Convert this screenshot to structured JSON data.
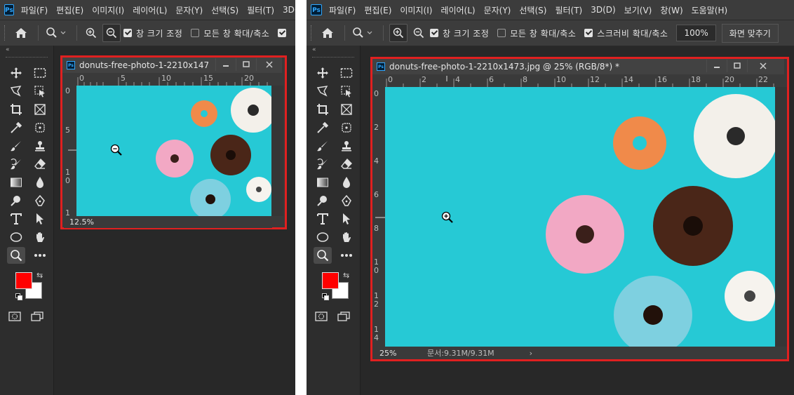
{
  "menu": [
    "파일(F)",
    "편집(E)",
    "이미지(I)",
    "레이어(L)",
    "문자(Y)",
    "선택(S)",
    "필터(T)",
    "3D(D)",
    "보기(V)",
    "창(W)",
    "도움말(H)"
  ],
  "options": {
    "fit_window": "창 크기 조정",
    "zoom_all": "모든 창 확대/축소",
    "scrubby_zoom": "스크러비 확대/축소",
    "percent": "100%",
    "fit_screen": "화면 맞추기"
  },
  "left_panel": {
    "doc_title": "donuts-free-photo-1-2210x147...",
    "zoom": "12.5%",
    "ruler_h": [
      "0",
      "5",
      "10",
      "15",
      "20"
    ],
    "ruler_v": [
      "0",
      "5",
      "10",
      "1"
    ],
    "active_zoom_tool": "zoom-out",
    "cursor": "zoom-out-cursor"
  },
  "right_panel": {
    "doc_title": "donuts-free-photo-1-2210x1473.jpg @ 25% (RGB/8*) *",
    "zoom": "25%",
    "doc_info": "문서:9.31M/9.31M",
    "ruler_h": [
      "0",
      "2",
      "4",
      "6",
      "8",
      "10",
      "12",
      "14",
      "16",
      "18",
      "20",
      "22"
    ],
    "ruler_v": [
      "0",
      "2",
      "4",
      "6",
      "8",
      "10",
      "12",
      "14"
    ],
    "active_zoom_tool": "zoom-in",
    "cursor": "zoom-in-cursor"
  },
  "colors": {
    "foreground": "#ff0000",
    "background": "#ffffff",
    "canvas_bg": "#26c9d5",
    "highlight_border": "#e02020"
  }
}
